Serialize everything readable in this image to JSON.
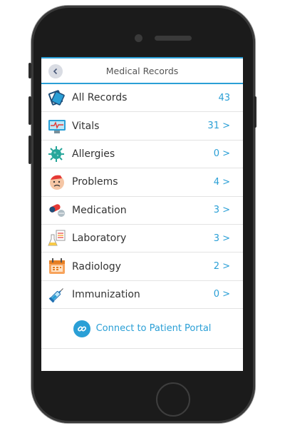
{
  "header": {
    "title": "Medical Records",
    "back_icon": "chevron-left-icon"
  },
  "records": [
    {
      "label": "All Records",
      "count": "43",
      "icon": "folder-icon"
    },
    {
      "label": "Vitals",
      "count": "31 >",
      "icon": "monitor-icon"
    },
    {
      "label": "Allergies",
      "count": "0 >",
      "icon": "germ-icon"
    },
    {
      "label": "Problems",
      "count": "4 >",
      "icon": "sick-face-icon"
    },
    {
      "label": "Medication",
      "count": "3 >",
      "icon": "pills-icon"
    },
    {
      "label": "Laboratory",
      "count": "3 >",
      "icon": "lab-flask-icon"
    },
    {
      "label": "Radiology",
      "count": "2 >",
      "icon": "calendar-icon"
    },
    {
      "label": "Immunization",
      "count": "0 >",
      "icon": "syringe-icon"
    }
  ],
  "portal": {
    "label": "Connect to Patient Portal",
    "icon": "link-icon"
  },
  "colors": {
    "accent": "#2a9fd6",
    "frame": "#1b1b1b"
  }
}
